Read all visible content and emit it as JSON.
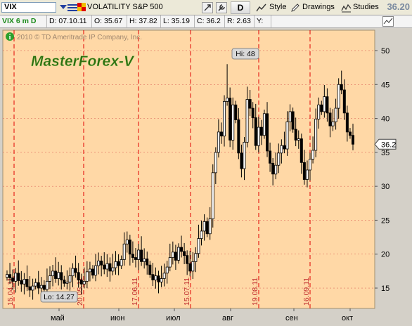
{
  "toolbar": {
    "symbol": "VIX",
    "instrument_name": "VOLATILITY S&P 500",
    "aggregation_button": "D",
    "style_label": "Style",
    "drawings_label": "Drawings",
    "studies_label": "Studies",
    "last_price": "36.20"
  },
  "infobar": {
    "period": "VIX 6 m D",
    "date": "D: 07.10.11",
    "open": "O: 35.67",
    "high": "H: 37.82",
    "low": "L: 35.19",
    "close": "C: 36.2",
    "range": "R: 2.63",
    "y": "Y:"
  },
  "chart": {
    "copyright": "2010 © TD Ameritrade IP Company, Inc.",
    "watermark": "MasterForex-V",
    "hi_label": "Hi: 48",
    "lo_label": "Lo: 14.27",
    "last_label": "36.2",
    "month_labels": [
      "май",
      "июн",
      "июл",
      "авг",
      "сен",
      "окт"
    ],
    "date_marks": [
      "15.04.11",
      "20.05.11",
      "17.06.11",
      "15.07.11",
      "19.08.11",
      "16.09.11"
    ],
    "colors": {
      "background": "#ffd8a6",
      "grid": "#e07060",
      "expiry_line": "#e00000",
      "date_text": "#c03030",
      "candle": "#000000"
    }
  },
  "chart_data": {
    "type": "candlestick",
    "title": "VOLATILITY S&P 500",
    "ylim": [
      12,
      53
    ],
    "yticks": [
      15,
      20,
      25,
      30,
      35,
      40,
      45,
      50
    ],
    "high": 48,
    "low": 14.27,
    "last": 36.2,
    "close": [
      17.0,
      16.5,
      16.0,
      17.2,
      16.1,
      15.6,
      16.3,
      15.2,
      14.7,
      15.3,
      15.8,
      15.0,
      15.4,
      14.8,
      16.0,
      16.8,
      17.5,
      16.4,
      17.3,
      16.2,
      15.7,
      15.9,
      16.8,
      17.9,
      17.3,
      16.2,
      15.6,
      16.0,
      17.4,
      17.8,
      16.9,
      18.3,
      19.0,
      18.4,
      17.8,
      18.6,
      17.5,
      18.0,
      18.9,
      18.3,
      19.2,
      21.5,
      22.1,
      20.0,
      19.5,
      19.2,
      20.6,
      18.9,
      19.3,
      18.4,
      17.0,
      16.2,
      16.8,
      15.9,
      16.4,
      17.2,
      18.1,
      19.5,
      20.3,
      19.1,
      21.0,
      20.4,
      19.8,
      18.6,
      17.5,
      18.9,
      20.1,
      22.3,
      23.4,
      24.8,
      23.0,
      25.2,
      32.0,
      35.0,
      38.0,
      37.4,
      42.5,
      43.0,
      36.8,
      42.0,
      39.8,
      34.9,
      32.6,
      36.5,
      42.8,
      41.5,
      40.1,
      36.0,
      38.7,
      37.5,
      40.7,
      35.2,
      33.4,
      31.8,
      33.1,
      34.9,
      36.0,
      35.5,
      39.5,
      41.0,
      38.4,
      36.8,
      37.0,
      33.5,
      31.0,
      32.4,
      34.0,
      35.3,
      39.9,
      42.0,
      41.0,
      43.2,
      40.8,
      38.9,
      39.5,
      41.5,
      45.0,
      44.2,
      40.8,
      38.0,
      37.5,
      36.2
    ]
  }
}
